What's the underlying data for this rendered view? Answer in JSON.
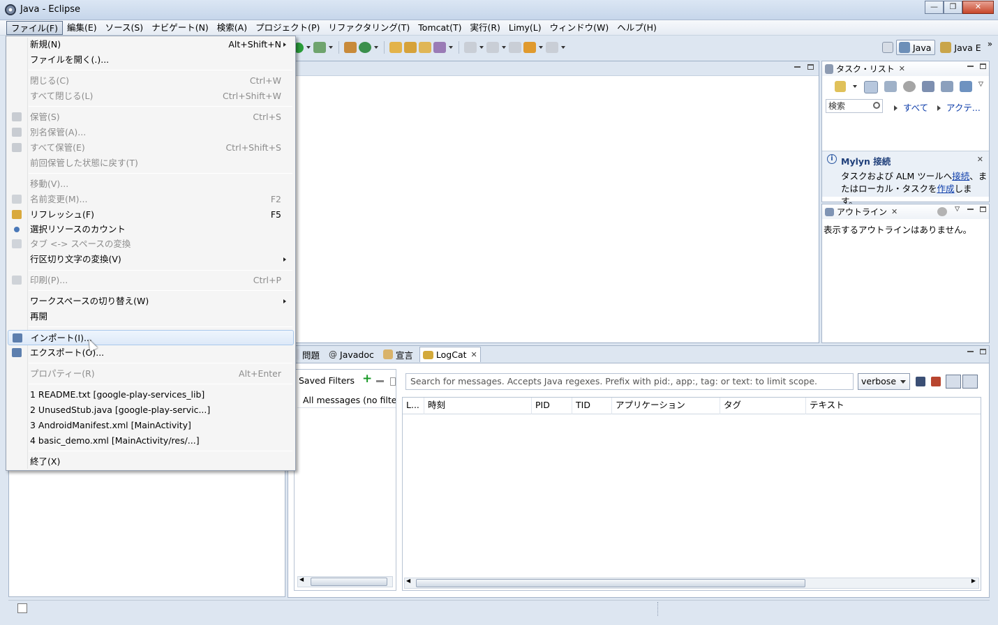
{
  "window": {
    "title": "Java - Eclipse",
    "minimize": "—",
    "maximize": "❐",
    "close": "✕"
  },
  "menubar": [
    "ファイル(F)",
    "編集(E)",
    "ソース(S)",
    "ナビゲート(N)",
    "検索(A)",
    "プロジェクト(P)",
    "リファクタリング(T)",
    "Tomcat(T)",
    "実行(R)",
    "Limy(L)",
    "ウィンドウ(W)",
    "ヘルプ(H)"
  ],
  "file_menu": {
    "new": {
      "label": "新規(N)",
      "accel": "Alt+Shift+N"
    },
    "open_file": {
      "label": "ファイルを開く(.)..."
    },
    "close": {
      "label": "閉じる(C)",
      "accel": "Ctrl+W"
    },
    "close_all": {
      "label": "すべて閉じる(L)",
      "accel": "Ctrl+Shift+W"
    },
    "save": {
      "label": "保管(S)",
      "accel": "Ctrl+S"
    },
    "save_as": {
      "label": "別名保管(A)..."
    },
    "save_all": {
      "label": "すべて保管(E)",
      "accel": "Ctrl+Shift+S"
    },
    "revert": {
      "label": "前回保管した状態に戻す(T)"
    },
    "move": {
      "label": "移動(V)..."
    },
    "rename": {
      "label": "名前変更(M)...",
      "accel": "F2"
    },
    "refresh": {
      "label": "リフレッシュ(F)",
      "accel": "F5"
    },
    "count": {
      "label": "選択リソースのカウント"
    },
    "tabs": {
      "label": "タブ <-> スペースの変換"
    },
    "line_delim": {
      "label": "行区切り文字の変換(V)"
    },
    "print": {
      "label": "印刷(P)...",
      "accel": "Ctrl+P"
    },
    "switch_ws": {
      "label": "ワークスペースの切り替え(W)"
    },
    "restart": {
      "label": "再開"
    },
    "import": {
      "label": "インポート(I)..."
    },
    "export": {
      "label": "エクスポート(O)..."
    },
    "properties": {
      "label": "プロパティー(R)",
      "accel": "Alt+Enter"
    },
    "recent1": {
      "label": "1 README.txt  [google-play-services_lib]"
    },
    "recent2": {
      "label": "2 UnusedStub.java  [google-play-servic...]"
    },
    "recent3": {
      "label": "3 AndroidManifest.xml  [MainActivity]"
    },
    "recent4": {
      "label": "4 basic_demo.xml  [MainActivity/res/...]"
    },
    "exit": {
      "label": "終了(X)"
    }
  },
  "perspectives": {
    "java": "Java",
    "java_ee": "Java E",
    "more": "»"
  },
  "task_list": {
    "title": "タスク・リスト",
    "search_placeholder": "検索",
    "all": "すべて",
    "activate": "アクテ...",
    "mylyn_title": "Mylyn 接続",
    "mylyn_text1": "タスクおよび ALM ツールへ",
    "mylyn_link1": "接続",
    "mylyn_text2": "、ま",
    "mylyn_text3": "たはローカル・タスクを",
    "mylyn_link2": "作成",
    "mylyn_text4": "します。"
  },
  "outline": {
    "title": "アウトライン",
    "empty": "表示するアウトラインはありません。"
  },
  "bottom_tabs": {
    "problems": "問題",
    "javadoc": "Javadoc",
    "declaration": "宣言",
    "logcat": "LogCat"
  },
  "logcat": {
    "saved_filters": "Saved Filters",
    "all_messages": "All messages (no filters)",
    "search_placeholder": "Search for messages. Accepts Java regexes. Prefix with pid:, app:, tag: or text: to limit scope.",
    "level": "verbose",
    "columns": [
      "L...",
      "時刻",
      "PID",
      "TID",
      "アプリケーション",
      "タグ",
      "テキスト"
    ]
  },
  "colors": {
    "accent": "#0b3ba9",
    "menu_hover": "#dde9f8",
    "chrome": "#dde6f1"
  }
}
